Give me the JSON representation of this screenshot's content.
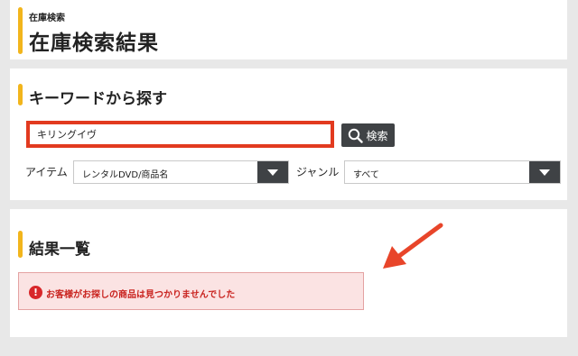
{
  "header": {
    "subtitle": "在庫検索",
    "title": "在庫検索結果"
  },
  "search_section": {
    "title": "キーワードから探す",
    "keyword_value": "キリングイヴ",
    "search_button_label": "検索",
    "item_label": "アイテム",
    "item_selected": "レンタルDVD/商品名",
    "genre_label": "ジャンル",
    "genre_selected": "すべて"
  },
  "results_section": {
    "title": "結果一覧",
    "alert_message": "お客様がお探しの商品は見つかりませんでした"
  },
  "colors": {
    "accent": "#f2b51c",
    "highlight_border": "#e23a1f",
    "button_dark": "#3f4245",
    "alert_background": "#fbe3e3",
    "alert_text": "#c9231f",
    "annotation_arrow": "#e8452a"
  },
  "icons": {
    "search_button_icon": "search-icon",
    "select_arrow_icon": "chevron-down-icon",
    "alert_icon": "exclamation-icon"
  }
}
